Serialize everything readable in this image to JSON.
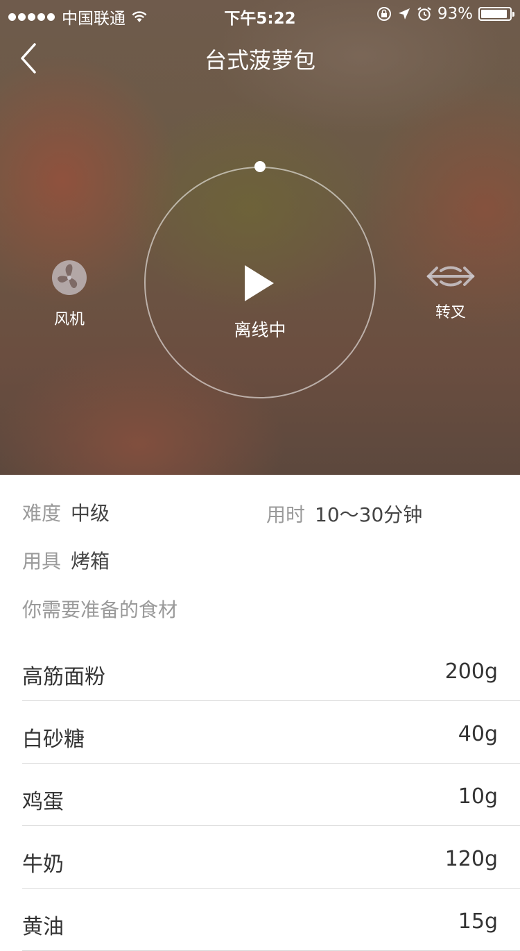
{
  "status_bar": {
    "carrier": "中国联通",
    "time": "下午5:22",
    "battery": "93%",
    "battery_level": 0.93
  },
  "header": {
    "title": "台式菠萝包"
  },
  "controls": {
    "fan_label": "风机",
    "ring_status": "离线中",
    "spit_label": "转叉"
  },
  "recipe": {
    "difficulty_label": "难度",
    "difficulty_value": "中级",
    "time_label": "用时",
    "time_value": "10～30分钟",
    "tool_label": "用具",
    "tool_value": "烤箱",
    "prep_title": "你需要准备的食材"
  },
  "ingredients": [
    {
      "name": "高筋面粉",
      "amount": "200g"
    },
    {
      "name": "白砂糖",
      "amount": "40g"
    },
    {
      "name": "鸡蛋",
      "amount": "10g"
    },
    {
      "name": "牛奶",
      "amount": "120g"
    },
    {
      "name": "黄油",
      "amount": "15g"
    }
  ],
  "icons": {
    "back": "chevron-left-icon",
    "play": "play-icon",
    "fan": "fan-icon",
    "spit": "rotisserie-spit-icon"
  }
}
